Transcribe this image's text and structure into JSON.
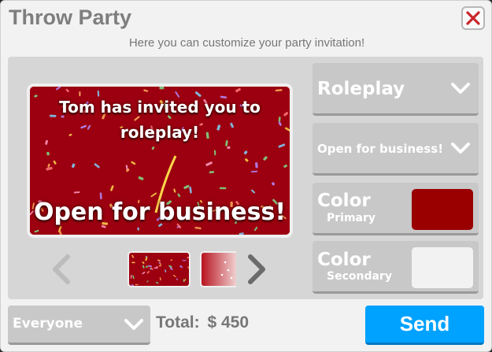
{
  "window": {
    "title": "Throw Party",
    "subtitle": "Here you can customize your party invitation!"
  },
  "invitation": {
    "header": "Tom has invited you to roleplay!",
    "header_line1": "Tom has invited you to",
    "header_line2": "roleplay!",
    "message": "Open for business!",
    "background_color": "#9c0010"
  },
  "options": {
    "party_type": "Roleplay",
    "message": "Open for business!",
    "primary_color": {
      "label": "Color",
      "sublabel": "Primary",
      "value": "#9a0000"
    },
    "secondary_color": {
      "label": "Color",
      "sublabel": "Secondary",
      "value": "#f2f2f2"
    }
  },
  "footer": {
    "audience": "Everyone",
    "total_label": "Total:",
    "total_value": "$ 450",
    "send_label": "Send"
  },
  "icons": [
    "close-icon",
    "chevron-left-icon",
    "chevron-right-icon",
    "chevron-down-icon"
  ],
  "colors": {
    "accent": "#00a2ff",
    "close": "#c8262b",
    "panel": "#d6d6d6"
  }
}
